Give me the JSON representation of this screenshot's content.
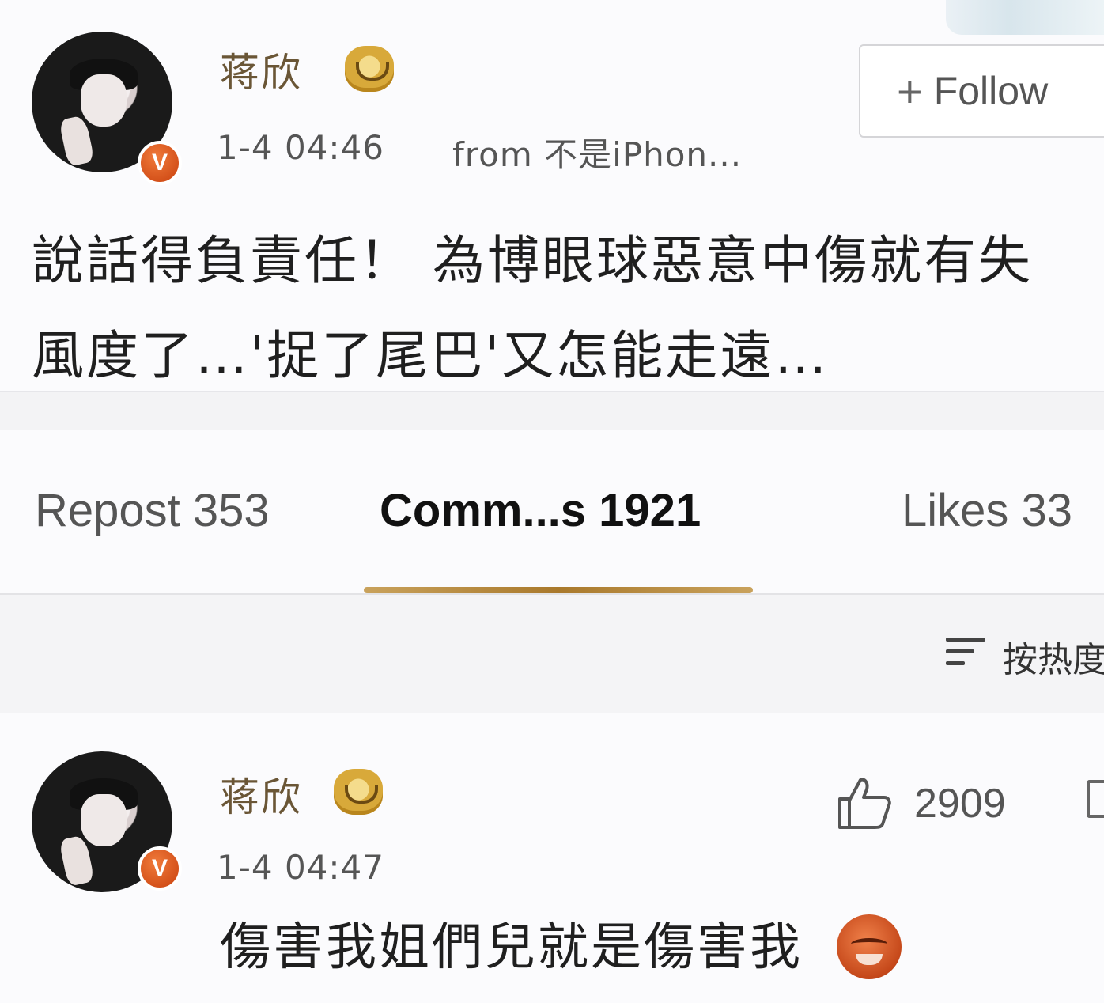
{
  "post": {
    "username": "蒋欣",
    "timestamp": "1-4 04:46",
    "source": "from 不是iPhon...",
    "follow_label": "Follow",
    "text": "說話得負責任！ 為博眼球惡意中傷就有失\n風度了…'捉了尾巴'又怎能走遠…"
  },
  "tabs": [
    {
      "label": "Repost 353",
      "active": false
    },
    {
      "label": "Comm...s 1921",
      "active": true
    },
    {
      "label": "Likes 33",
      "active": false
    }
  ],
  "sort": {
    "label": "按热度"
  },
  "comment": {
    "username": "蒋欣",
    "timestamp": "1-4 04:47",
    "likes": "2909",
    "text": "傷害我姐們兒就是傷害我"
  },
  "icons": {
    "verified_badge": "V",
    "accent": "#a9792c",
    "badge_color": "#d9541a"
  }
}
